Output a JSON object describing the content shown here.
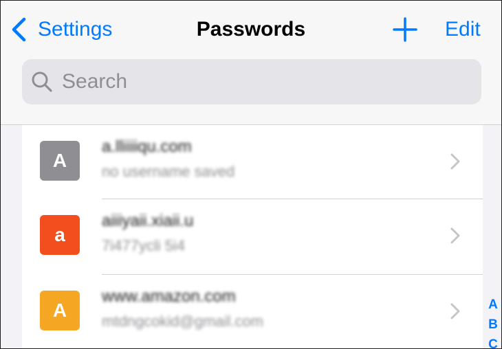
{
  "navbar": {
    "back_label": "Settings",
    "title": "Passwords",
    "edit_label": "Edit"
  },
  "search": {
    "placeholder": "Search"
  },
  "colors": {
    "accent": "#007aff"
  },
  "passwords": [
    {
      "tile_letter": "A",
      "tile_color": "#8e8e93",
      "site": "a.lliiiiqu.com",
      "username": "no username saved"
    },
    {
      "tile_letter": "a",
      "tile_color": "#f24e1e",
      "site": "aiiiyaii.xiaii.u",
      "username": "7i477ycli 5i4"
    },
    {
      "tile_letter": "A",
      "tile_color": "#f5a623",
      "site": "www.amazon.com",
      "username": "mtdngcokid@gmail.com"
    }
  ],
  "index_letters": [
    "A",
    "B",
    "C"
  ]
}
